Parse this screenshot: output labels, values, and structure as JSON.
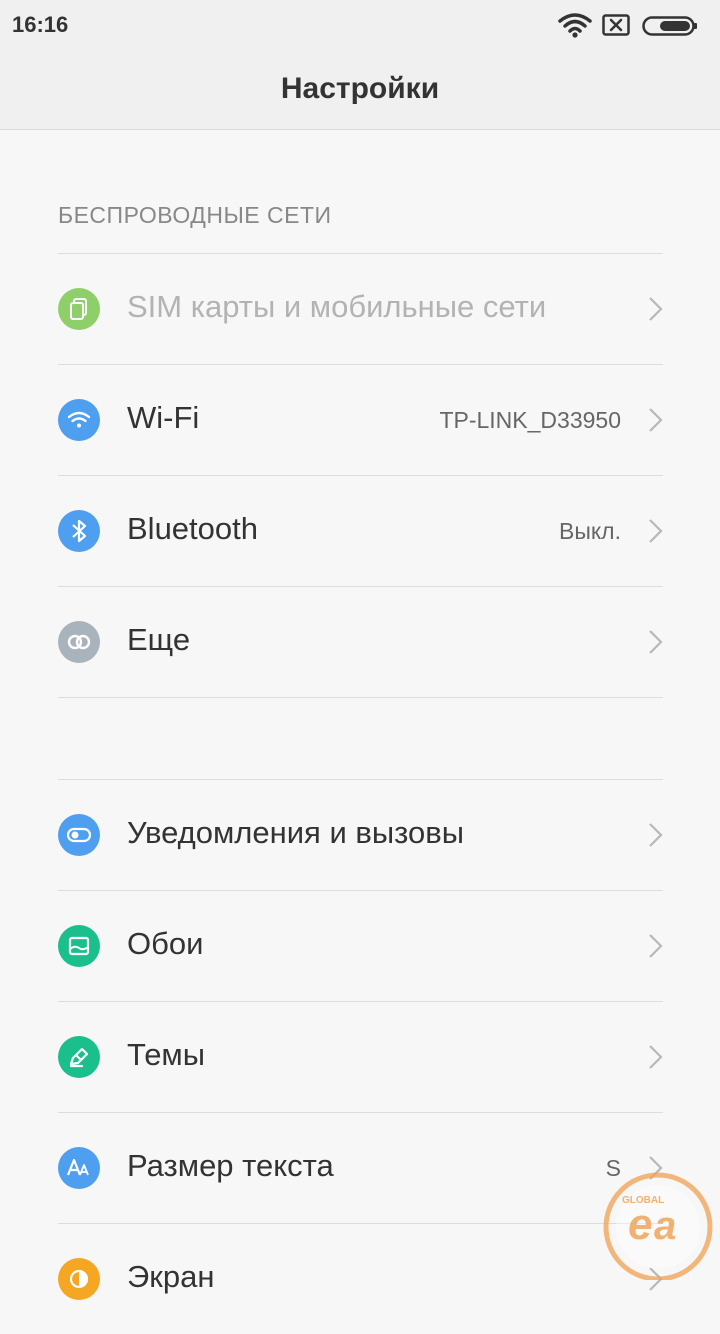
{
  "status_bar": {
    "time": "16:16"
  },
  "title": "Настройки",
  "sections": {
    "wireless_header": "БЕСПРОВОДНЫЕ СЕТИ"
  },
  "rows": [
    {
      "label": "SIM карты и мобильные сети",
      "value": "",
      "icon": "sim-cards-icon",
      "color": "#8fcf6a"
    },
    {
      "label": "Wi-Fi",
      "value": "TP-LINK_D33950",
      "icon": "wifi-icon",
      "color": "#4e9ff0"
    },
    {
      "label": "Bluetooth",
      "value": "Выкл.",
      "icon": "bluetooth-icon",
      "color": "#4e9ff0"
    },
    {
      "label": "Еще",
      "value": "",
      "icon": "link-icon",
      "color": "#a9b3bb"
    },
    {
      "label": "Уведомления и вызовы",
      "value": "",
      "icon": "toggle-icon",
      "color": "#4e9ff0"
    },
    {
      "label": "Обои",
      "value": "",
      "icon": "wallpaper-icon",
      "color": "#1bbf8c"
    },
    {
      "label": "Темы",
      "value": "",
      "icon": "themes-brush-icon",
      "color": "#1bbf8c"
    },
    {
      "label": "Размер текста",
      "value": "S",
      "icon": "text-size-icon",
      "color": "#4e9ff0"
    },
    {
      "label": "Экран",
      "value": "",
      "icon": "display-icon",
      "color": "#f5a623"
    }
  ],
  "watermark_text": "GLOBAL easy"
}
